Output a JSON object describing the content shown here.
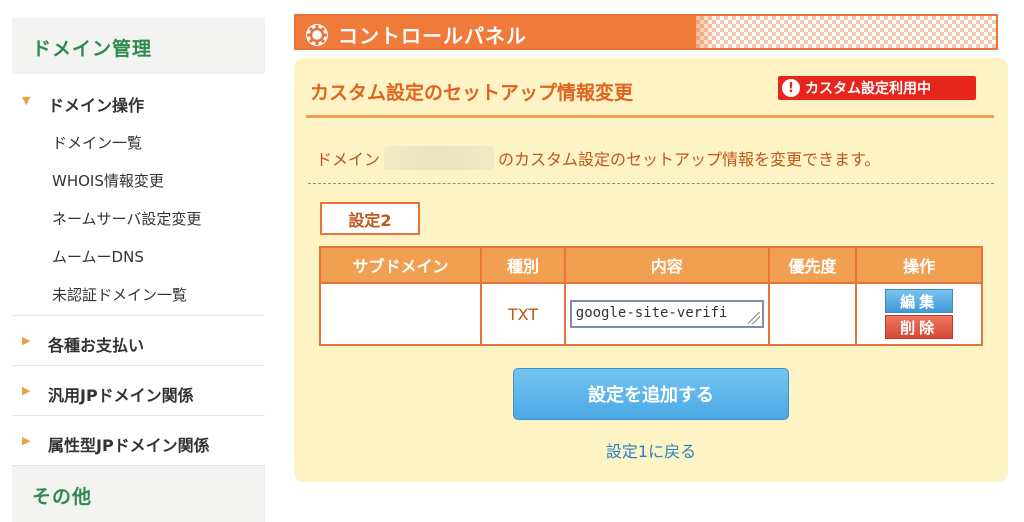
{
  "sidebar": {
    "heading": "ドメイン管理",
    "open_section": {
      "label": "ドメイン操作",
      "items": [
        "ドメイン一覧",
        "WHOIS情報変更",
        "ネームサーバ設定変更",
        "ムームーDNS",
        "未認証ドメイン一覧"
      ]
    },
    "sections": [
      "各種お支払い",
      "汎用JPドメイン関係",
      "属性型JPドメイン関係"
    ],
    "footer_heading": "その他"
  },
  "header": {
    "title": "コントロールパネル",
    "icon": "gear-icon"
  },
  "panel": {
    "title": "カスタム設定のセットアップ情報変更",
    "badge": "カスタム設定利用中",
    "badge_icon": "!",
    "desc_prefix": "ドメイン",
    "desc_suffix": "のカスタム設定のセットアップ情報を変更できます。",
    "setting_label": "設定2",
    "table": {
      "headers": [
        "サブドメイン",
        "種別",
        "内容",
        "優先度",
        "操作"
      ],
      "row": {
        "subdomain": "",
        "type": "TXT",
        "content": "google-site-verifi",
        "priority": "",
        "edit_label": "編集",
        "delete_label": "削除"
      }
    },
    "add_button": "設定を追加する",
    "back_link": "設定1に戻る"
  },
  "colors": {
    "accent_orange": "#ef7a3a",
    "panel_bg": "#fdf3c5",
    "sidebar_green": "#2e8a4e",
    "badge_red": "#e8251d",
    "button_blue": "#4aa9e4"
  }
}
